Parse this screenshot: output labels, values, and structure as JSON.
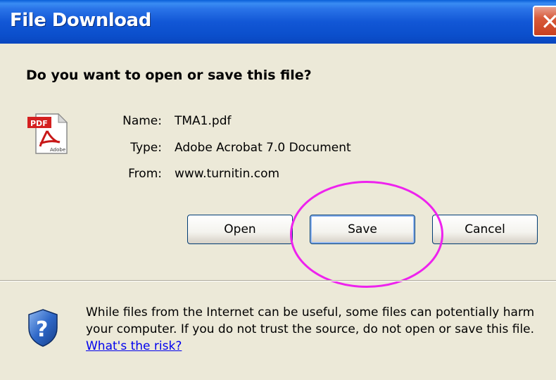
{
  "window": {
    "title": "File Download",
    "close_label": "✕"
  },
  "prompt": {
    "question": "Do you want to open or save this file?"
  },
  "file": {
    "icon": "pdf-file-icon",
    "name_label": "Name:",
    "name": "TMA1.pdf",
    "type_label": "Type:",
    "type": "Adobe Acrobat 7.0 Document",
    "from_label": "From:",
    "from": "www.turnitin.com"
  },
  "buttons": {
    "open": "Open",
    "save": "Save",
    "cancel": "Cancel"
  },
  "warning": {
    "icon": "security-shield-question-icon",
    "text": "While files from the Internet can be useful, some files can potentially harm your computer. If you do not trust the source, do not open or save this file. ",
    "link": "What's the risk?"
  },
  "colors": {
    "titlebar": "#0a4fcc",
    "dialog_bg": "#ece9d8",
    "highlight_ring": "#ee22ee",
    "link": "#0000ee"
  }
}
